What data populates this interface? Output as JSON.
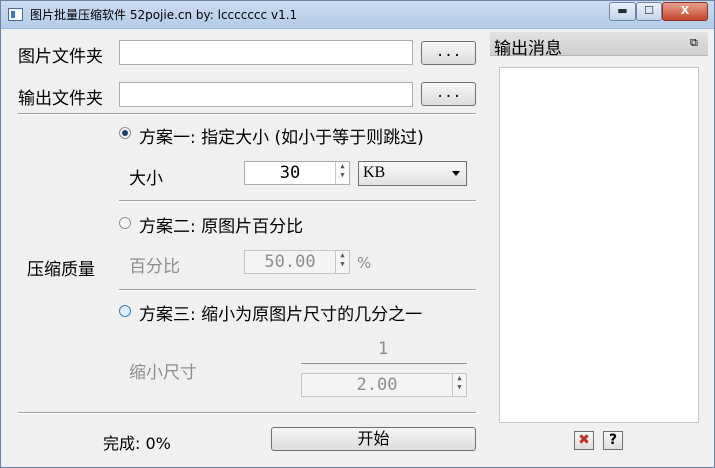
{
  "window": {
    "title": "图片批量压缩软件  52pojie.cn   by: lccccccc     v1.1",
    "min_glyph": "▬",
    "max_glyph": "☐",
    "close_glyph": "X"
  },
  "form": {
    "image_folder_label": "图片文件夹",
    "image_folder_value": "",
    "output_folder_label": "输出文件夹",
    "output_folder_value": "",
    "browse_label": "...",
    "compress_quality_label": "压缩质量",
    "plan1": {
      "label": "方案一: 指定大小 (如小于等于则跳过)",
      "size_label": "大小",
      "size_value": "30",
      "unit_value": "KB"
    },
    "plan2": {
      "label": "方案二: 原图片百分比",
      "percent_label": "百分比",
      "percent_value": "50.00",
      "percent_unit": "%"
    },
    "plan3": {
      "label": "方案三: 缩小为原图片尺寸的几分之一",
      "shrink_label": "缩小尺寸",
      "numerator": "1",
      "denominator_value": "2.00"
    },
    "progress_label": "完成: 0%",
    "start_button": "开始",
    "selected_plan": "plan1"
  },
  "output_panel": {
    "title": "输出消息",
    "float_glyph": "⧉",
    "close_glyph": "✖",
    "help_glyph": "?"
  },
  "colors": {
    "titlebar": "#b5cbe8",
    "close_button": "#c4452c",
    "radio_selected": "#1c3f73",
    "disabled_text": "#8d8d8d"
  }
}
